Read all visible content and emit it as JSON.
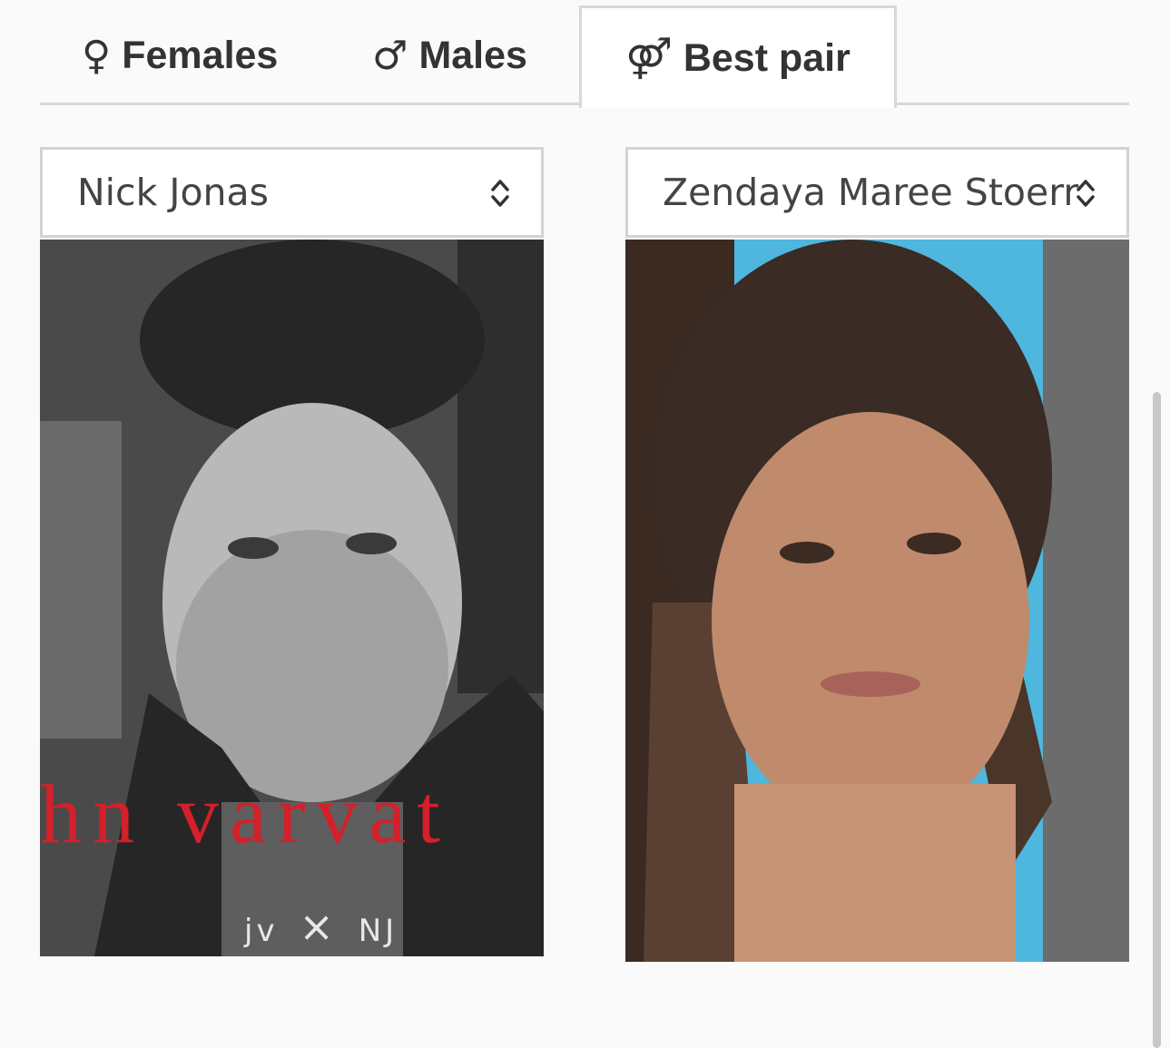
{
  "tabs": [
    {
      "symbol": "♀",
      "label": "Females"
    },
    {
      "symbol": "♂",
      "label": "Males"
    },
    {
      "symbol": "⚤",
      "label": "Best pair"
    }
  ],
  "selects": {
    "left": {
      "value": "Nick Jonas"
    },
    "right": {
      "value": "Zendaya Maree Stoerr"
    }
  },
  "photos": {
    "left": {
      "overlay_text": "hn varvat",
      "brand_left": "jv",
      "brand_right": "NJ"
    }
  },
  "colors": {
    "overlay_red": "#d4202a",
    "tab_border": "#d8d8d8",
    "text": "#333333"
  }
}
